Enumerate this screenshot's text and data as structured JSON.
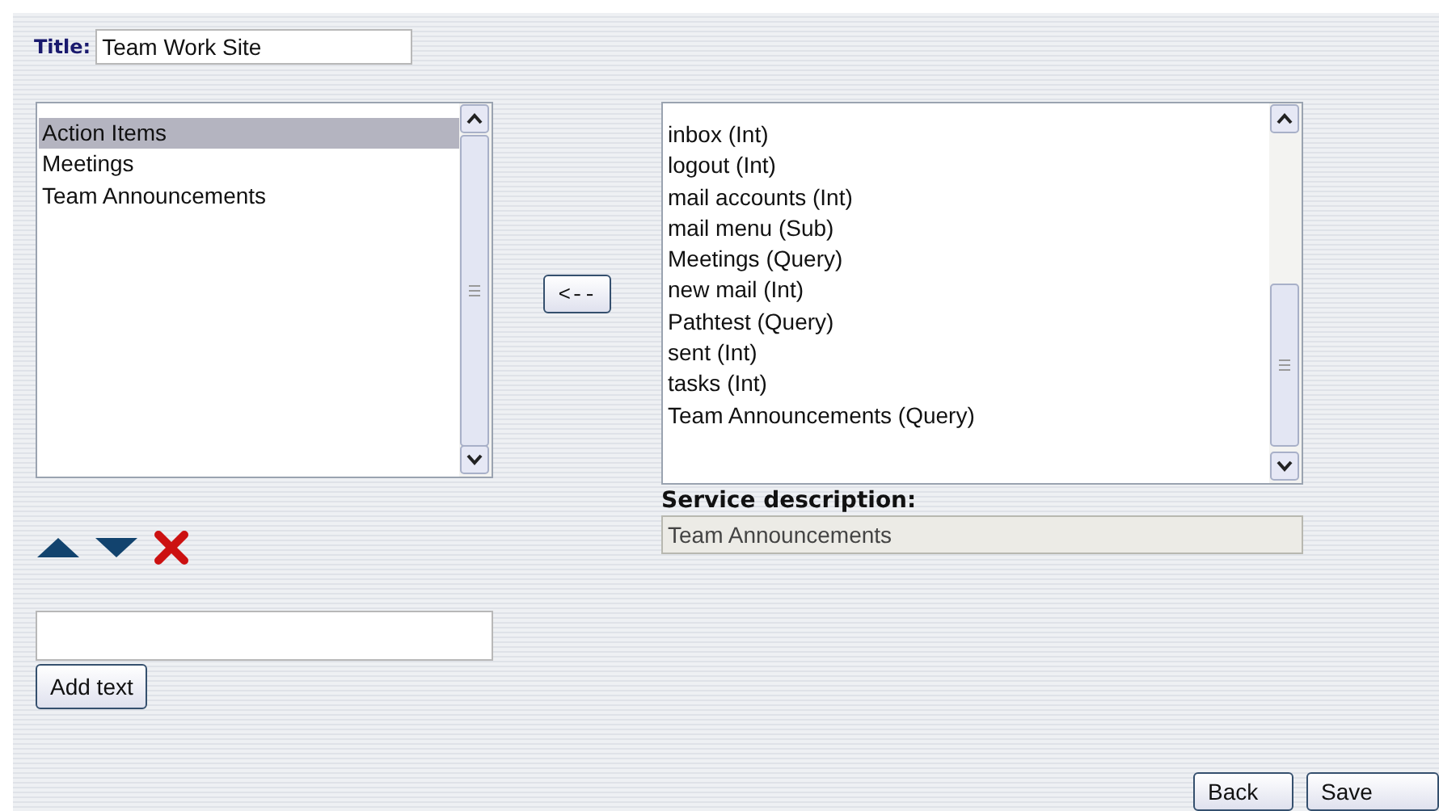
{
  "title_field": {
    "label": "Title:",
    "value": "Team Work Site"
  },
  "selected_services": {
    "items": [
      {
        "label": "Action Items",
        "selected": true
      },
      {
        "label": "Meetings",
        "selected": false
      },
      {
        "label": "Team Announcements",
        "selected": false
      }
    ]
  },
  "move_button": {
    "label": "<--"
  },
  "available_services": {
    "items": [
      {
        "label": "inbox (Int)",
        "selected": false
      },
      {
        "label": "logout (Int)",
        "selected": false
      },
      {
        "label": "mail accounts (Int)",
        "selected": false
      },
      {
        "label": "mail menu (Sub)",
        "selected": false
      },
      {
        "label": "Meetings (Query)",
        "selected": false
      },
      {
        "label": "new mail (Int)",
        "selected": false
      },
      {
        "label": "Pathtest (Query)",
        "selected": false
      },
      {
        "label": "sent (Int)",
        "selected": false
      },
      {
        "label": "tasks (Int)",
        "selected": false
      },
      {
        "label": "Team Announcements (Query)",
        "selected": false
      }
    ]
  },
  "service_description": {
    "label": "Service description:",
    "value": "Team Announcements"
  },
  "add_text": {
    "button": "Add text"
  },
  "buttons": [
    {
      "label": "Back"
    },
    {
      "label": "Save"
    }
  ]
}
